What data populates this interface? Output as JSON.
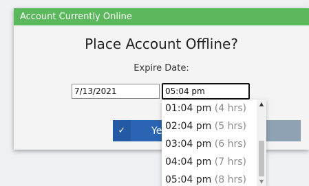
{
  "dialog": {
    "title": "Account Currently Online",
    "heading": "Place Account Offline?",
    "expire_label": "Expire Date:",
    "date_value": "7/13/2021",
    "time_value": "05:04 pm",
    "yes_label": "Ye",
    "yes_icon": "checkmark-icon"
  },
  "dropdown": {
    "items": [
      {
        "time": "01:04 pm",
        "hrs": "(4 hrs)"
      },
      {
        "time": "02:04 pm",
        "hrs": "(5 hrs)"
      },
      {
        "time": "03:04 pm",
        "hrs": "(6 hrs)"
      },
      {
        "time": "04:04 pm",
        "hrs": "(7 hrs)"
      },
      {
        "time": "05:04 pm",
        "hrs": "(8 hrs)"
      }
    ]
  },
  "colors": {
    "titlebar": "#5cb85c",
    "primary_button": "#2a64b3",
    "secondary_button": "#8fa2b3"
  }
}
